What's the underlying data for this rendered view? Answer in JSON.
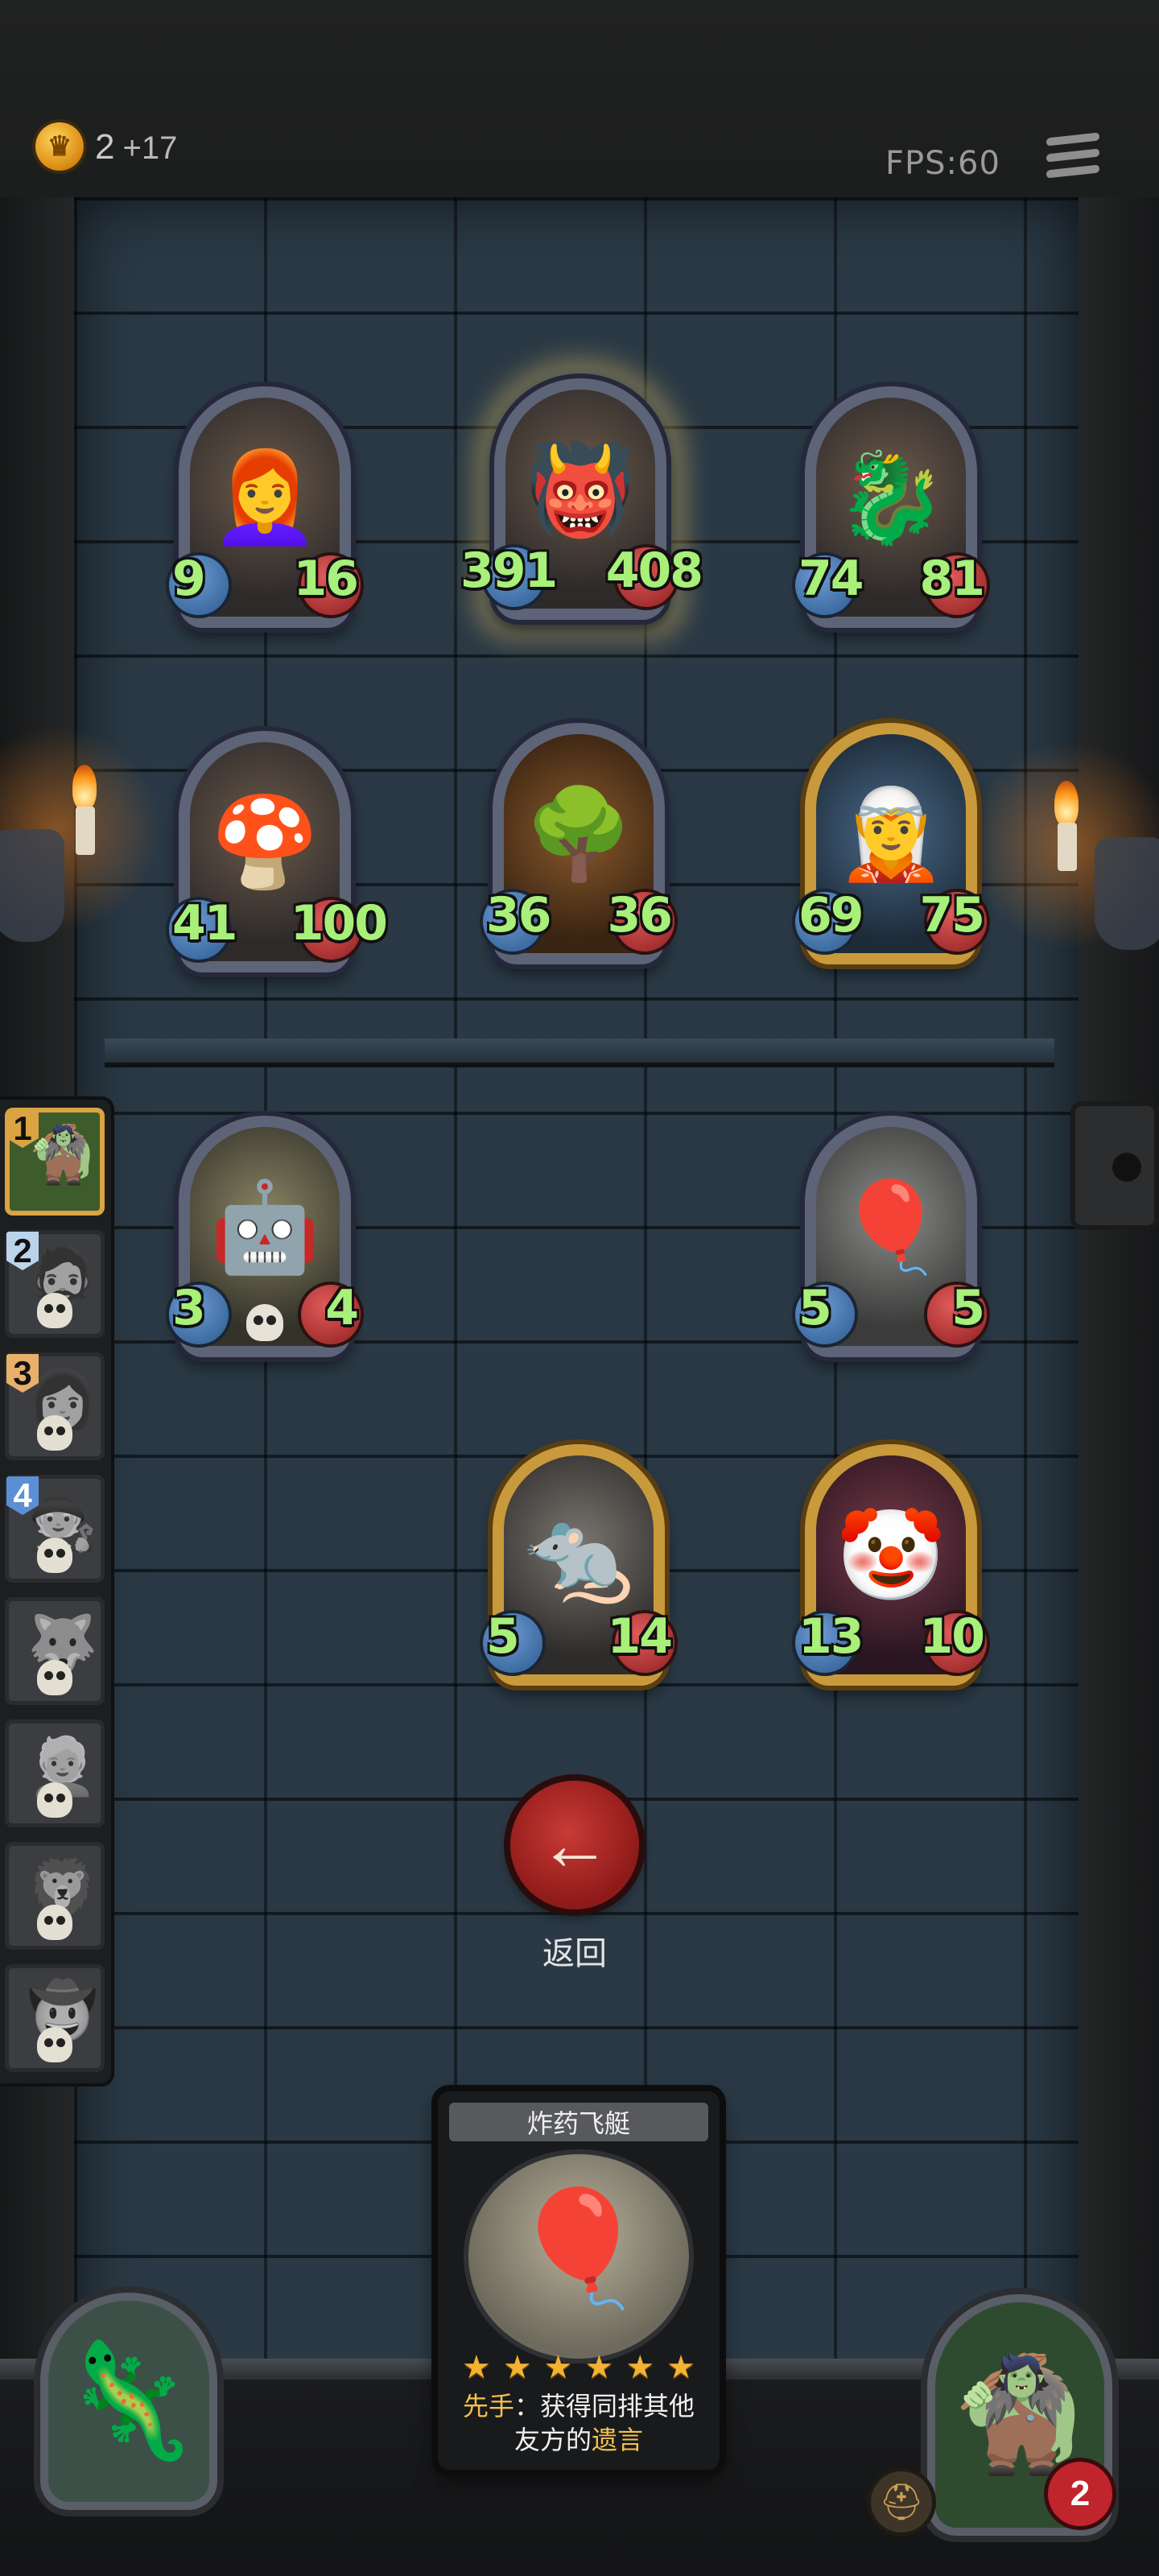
{
  "header": {
    "gold": "2",
    "gold_income": "+17",
    "fps": "FPS:60"
  },
  "board": {
    "cards": [
      {
        "id": "r1c1",
        "attack": "9",
        "health": "16",
        "frame": "blue",
        "art": "red-haired-woman",
        "emoji": "👩‍🦰"
      },
      {
        "id": "r1c2",
        "attack": "391",
        "health": "408",
        "frame": "blue",
        "art": "green-fanged-monster",
        "emoji": "👹",
        "selected": true
      },
      {
        "id": "r1c3",
        "attack": "74",
        "health": "81",
        "frame": "blue",
        "art": "red-dragon",
        "emoji": "🐉"
      },
      {
        "id": "r2c1",
        "attack": "41",
        "health": "100",
        "frame": "blue",
        "art": "mushroom-creature",
        "emoji": "🍄"
      },
      {
        "id": "r2c2",
        "attack": "36",
        "health": "36",
        "frame": "blue",
        "art": "evil-tree",
        "emoji": "🌳"
      },
      {
        "id": "r2c3",
        "attack": "69",
        "health": "75",
        "frame": "gold",
        "art": "blue-haired-elf",
        "emoji": "🧝"
      },
      {
        "id": "r3c1",
        "attack": "3",
        "health": "4",
        "frame": "blue",
        "art": "robot-can",
        "emoji": "🤖",
        "deathrattle": true
      },
      {
        "id": "r3c3",
        "attack": "5",
        "health": "5",
        "frame": "blue",
        "art": "blimp",
        "emoji": "🎈"
      },
      {
        "id": "r4c2",
        "attack": "5",
        "health": "14",
        "frame": "gold",
        "art": "rat-bandit",
        "emoji": "🐀"
      },
      {
        "id": "r4c3",
        "attack": "13",
        "health": "10",
        "frame": "gold",
        "art": "clown",
        "emoji": "🤡"
      }
    ]
  },
  "sidebar": {
    "slots": [
      {
        "num": "1",
        "emoji": "🧌",
        "active": true,
        "color": "#d9a441"
      },
      {
        "num": "2",
        "emoji": "🧔",
        "color": "#bcd3ec"
      },
      {
        "num": "3",
        "emoji": "👩",
        "color": "#e8b06b"
      },
      {
        "num": "4",
        "emoji": "🧙",
        "color": "#5a8fd6"
      },
      {
        "num": "",
        "emoji": "🐺"
      },
      {
        "num": "",
        "emoji": "👱"
      },
      {
        "num": "",
        "emoji": "🦁"
      },
      {
        "num": "",
        "emoji": "🤠"
      }
    ]
  },
  "return": {
    "label": "返回",
    "icon": "arrow-left-icon"
  },
  "info_card": {
    "title": "炸药飞艇",
    "stars": [
      "★",
      "★",
      "★",
      "★",
      "★",
      "★"
    ],
    "desc_key1": "先手",
    "desc_mid": "：获得同排其他友方的",
    "desc_key2": "遗言",
    "emoji": "🎈"
  },
  "player": {
    "health": "2",
    "emoji": "🧌"
  },
  "opponent": {
    "emoji": "🦎"
  },
  "colors": {
    "attack": "#a8f07a",
    "gold_frame": "#c89a3c",
    "blue_frame": "#5d6478",
    "accent_red": "#c93a35"
  }
}
